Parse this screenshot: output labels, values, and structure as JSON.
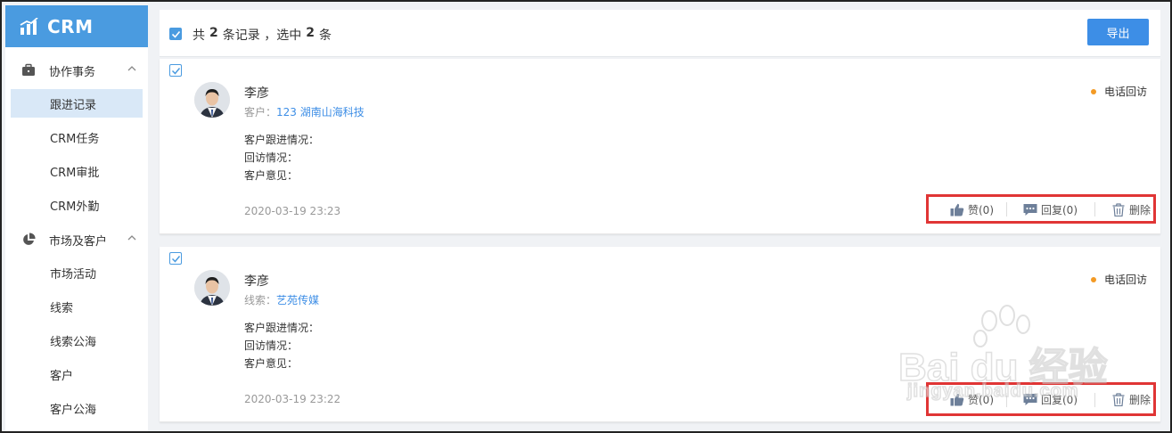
{
  "brand": {
    "name": "CRM",
    "icon": "bar-chart-icon",
    "color": "#4a9be0"
  },
  "sidebar": {
    "groups": [
      {
        "label": "协作事务",
        "icon": "briefcase-icon",
        "items": [
          {
            "label": "跟进记录",
            "active": true
          },
          {
            "label": "CRM任务"
          },
          {
            "label": "CRM审批"
          },
          {
            "label": "CRM外勤"
          }
        ]
      },
      {
        "label": "市场及客户",
        "icon": "pie-chart-icon",
        "items": [
          {
            "label": "市场活动"
          },
          {
            "label": "线索"
          },
          {
            "label": "线索公海"
          },
          {
            "label": "客户"
          },
          {
            "label": "客户公海"
          }
        ]
      }
    ]
  },
  "toolbar": {
    "summary_prefix": "共",
    "total": "2",
    "summary_mid": "条记录 ，选中",
    "selected": "2",
    "summary_suffix": "条",
    "export_label": "导出"
  },
  "records": [
    {
      "name": "李彦",
      "relation_label": "客户：",
      "relation_link": "123 湖南山海科技",
      "fields": [
        "客户跟进情况：",
        "回访情况：",
        "客户意见："
      ],
      "time": "2020-03-19 23:23",
      "type": "电话回访",
      "like_label": "赞(0)",
      "reply_label": "回复(0)",
      "delete_label": "删除"
    },
    {
      "name": "李彦",
      "relation_label": "线索：",
      "relation_link": "艺苑传媒",
      "fields": [
        "客户跟进情况：",
        "回访情况：",
        "客户意见："
      ],
      "time": "2020-03-19 23:22",
      "type": "电话回访",
      "like_label": "赞(0)",
      "reply_label": "回复(0)",
      "delete_label": "删除"
    }
  ],
  "watermark": {
    "brand": "Bai du 经验",
    "url": "jingyan.baidu.com"
  },
  "colors": {
    "accent": "#3d8ee6",
    "status_dot": "#f39a24",
    "highlight_box": "#e03535"
  }
}
